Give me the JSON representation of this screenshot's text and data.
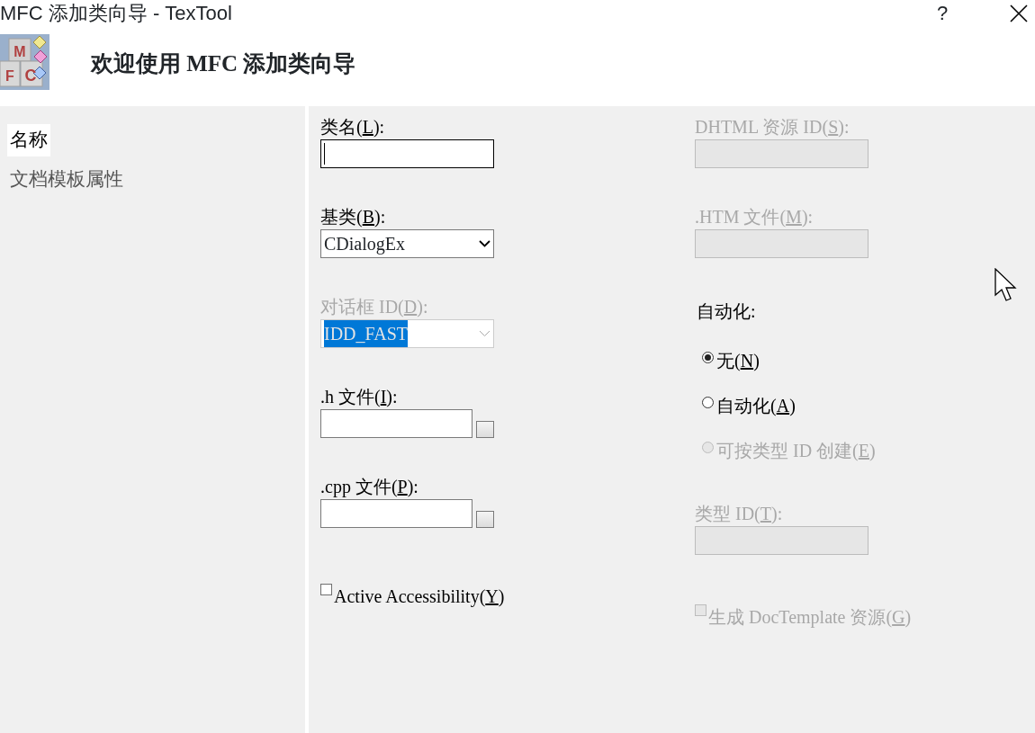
{
  "window": {
    "title": "MFC 添加类向导 - TexTool",
    "help": "?"
  },
  "header": {
    "logo_letters": [
      "M",
      "F",
      "C"
    ],
    "title": "欢迎使用 MFC 添加类向导"
  },
  "sidebar": {
    "items": [
      {
        "label": "名称",
        "selected": true
      },
      {
        "label": "文档模板属性",
        "selected": false
      }
    ]
  },
  "left_column": [
    {
      "kind": "text",
      "label": [
        "类名(",
        "L",
        "):"
      ],
      "focused": true,
      "disabled": false
    },
    {
      "kind": "select",
      "label": [
        "基类(",
        "B",
        "):"
      ],
      "value": "CDialogEx",
      "disabled": false,
      "highlighted": false
    },
    {
      "kind": "select",
      "label": [
        "对话框 ID(",
        "D",
        "):"
      ],
      "value": "IDD_FAST",
      "disabled": true,
      "highlighted": true
    },
    {
      "kind": "text",
      "label": [
        ".h 文件(",
        "I",
        "):"
      ],
      "focused": false,
      "disabled": false,
      "browse": true
    },
    {
      "kind": "text",
      "label": [
        ".cpp 文件(",
        "P",
        "):"
      ],
      "focused": false,
      "disabled": false,
      "browse": true
    },
    {
      "kind": "checkbox",
      "label": [
        "Active Accessibility(",
        "Y",
        ")"
      ],
      "checked": false,
      "disabled": false
    }
  ],
  "right_column": [
    {
      "kind": "text",
      "label": [
        "DHTML 资源 ID(",
        "S",
        "):"
      ],
      "focused": false,
      "disabled": true
    },
    {
      "kind": "text",
      "label": [
        ".HTM 文件(",
        "M",
        "):"
      ],
      "focused": false,
      "disabled": true
    },
    {
      "kind": "heading",
      "label": [
        "自动化:"
      ],
      "disabled": false
    },
    {
      "kind": "radio",
      "label": [
        "无(",
        "N",
        ")"
      ],
      "selected": true,
      "disabled": false
    },
    {
      "kind": "radio",
      "label": [
        "自动化(",
        "A",
        ")"
      ],
      "selected": false,
      "disabled": false
    },
    {
      "kind": "radio",
      "label": [
        "可按类型 ID 创建(",
        "E",
        ")"
      ],
      "selected": false,
      "disabled": true
    },
    {
      "kind": "text",
      "label": [
        "类型 ID(",
        "T",
        "):"
      ],
      "focused": false,
      "disabled": true
    },
    {
      "kind": "checkbox",
      "label": [
        "生成 DocTemplate 资源(",
        "G",
        ")"
      ],
      "checked": false,
      "disabled": true
    }
  ]
}
